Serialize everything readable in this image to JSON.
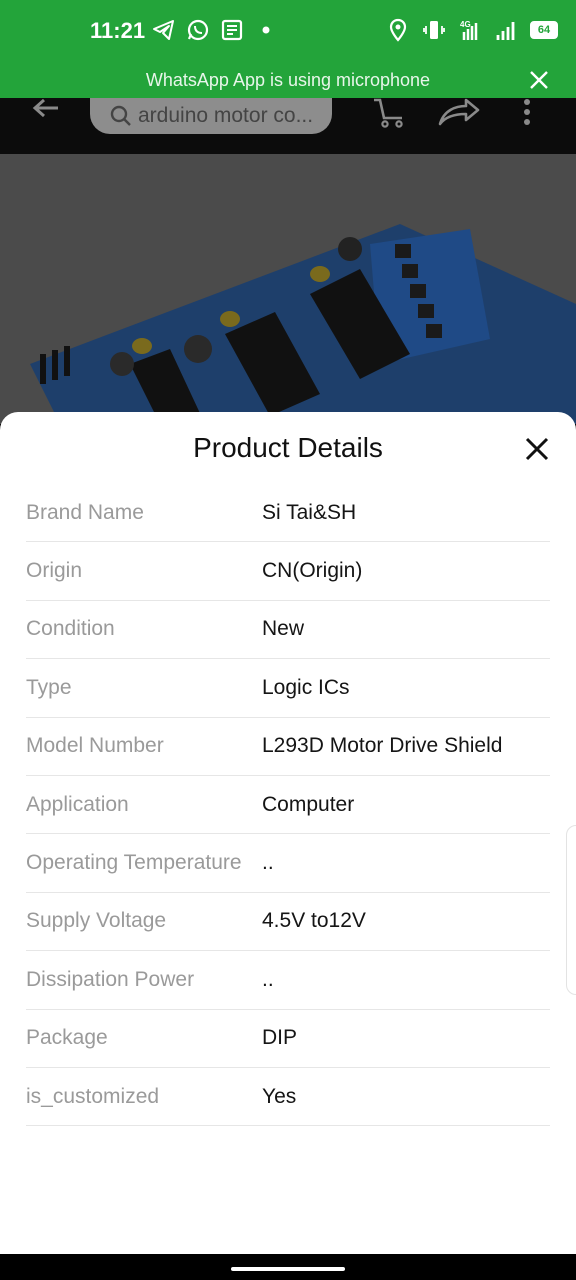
{
  "status_bar": {
    "time": "11:21",
    "battery": "64",
    "network": "4G"
  },
  "mic_banner": {
    "text": "WhatsApp App is using microphone"
  },
  "toolbar": {
    "search_text": "arduino motor co..."
  },
  "sheet": {
    "title": "Product Details",
    "rows": [
      {
        "key": "Brand Name",
        "value": "Si Tai&SH"
      },
      {
        "key": "Origin",
        "value": "CN(Origin)"
      },
      {
        "key": "Condition",
        "value": "New"
      },
      {
        "key": "Type",
        "value": "Logic ICs"
      },
      {
        "key": "Model Number",
        "value": "L293D Motor Drive Shield"
      },
      {
        "key": "Application",
        "value": "Computer"
      },
      {
        "key": "Operating Temperature",
        "value": ".."
      },
      {
        "key": "Supply Voltage",
        "value": "4.5V to12V"
      },
      {
        "key": "Dissipation Power",
        "value": ".."
      },
      {
        "key": "Package",
        "value": "DIP"
      },
      {
        "key": "is_customized",
        "value": "Yes"
      }
    ]
  },
  "colors": {
    "status_green": "#23a43a",
    "sheet_bg": "#ffffff",
    "key_gray": "#9a9a9a",
    "value_black": "#151515"
  }
}
